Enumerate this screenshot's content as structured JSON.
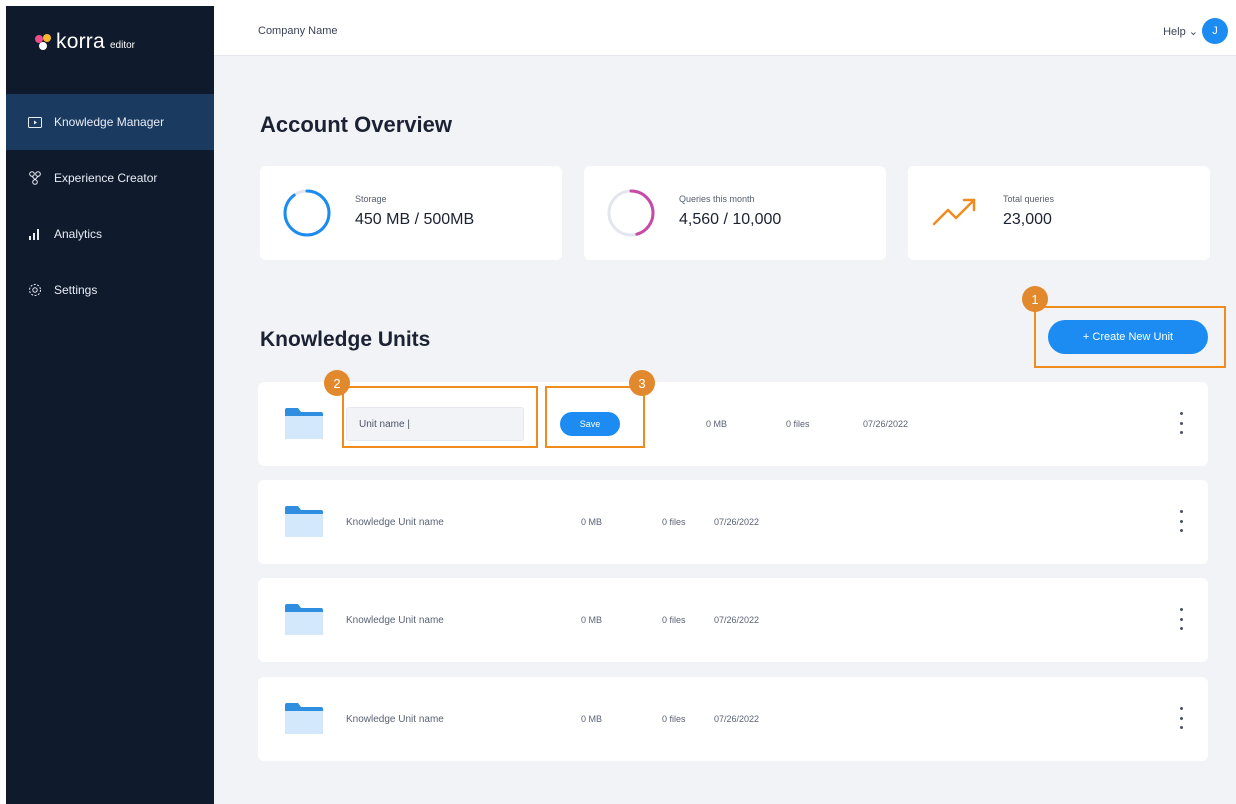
{
  "app": {
    "logo_text": "korra",
    "logo_sub": "editor"
  },
  "sidebar": {
    "items": [
      {
        "label": "Knowledge Manager",
        "icon": "folder-play-icon",
        "active": true
      },
      {
        "label": "Experience Creator",
        "icon": "nodes-icon",
        "active": false
      },
      {
        "label": "Analytics",
        "icon": "bar-chart-icon",
        "active": false
      },
      {
        "label": "Settings",
        "icon": "gear-icon",
        "active": false
      }
    ]
  },
  "topbar": {
    "company": "Company Name",
    "help": "Help ⌄",
    "avatar_initial": "J"
  },
  "overview": {
    "title": "Account Overview",
    "stats": [
      {
        "label": "Storage",
        "value": "450 MB / 500MB",
        "icon": "storage-ring-icon",
        "color": "#1c8cf2",
        "fraction": 0.9
      },
      {
        "label": "Queries this month",
        "value": "4,560 / 10,000",
        "icon": "queries-ring-icon",
        "color": "#c64aa6",
        "fraction": 0.456
      },
      {
        "label": "Total queries",
        "value": "23,000",
        "icon": "trending-up-icon",
        "color": "#f08c1e"
      }
    ]
  },
  "units": {
    "title": "Knowledge Units",
    "create_label": "+ Create New Unit",
    "editing": {
      "input_value": "Unit name |",
      "save_label": "Save",
      "size": "0 MB",
      "files": "0 files",
      "date": "07/26/2022"
    },
    "rows": [
      {
        "name": "Knowledge Unit name",
        "size": "0 MB",
        "files": "0 files",
        "date": "07/26/2022"
      },
      {
        "name": "Knowledge Unit name",
        "size": "0 MB",
        "files": "0 files",
        "date": "07/26/2022"
      },
      {
        "name": "Knowledge Unit name",
        "size": "0 MB",
        "files": "0 files",
        "date": "07/26/2022"
      }
    ]
  },
  "callouts": [
    "1",
    "2",
    "3"
  ],
  "colors": {
    "sidebar_bg": "#0f1b2d",
    "sidebar_active": "#1a3a5f",
    "accent": "#1c8cf2",
    "callout": "#f08c1e"
  }
}
